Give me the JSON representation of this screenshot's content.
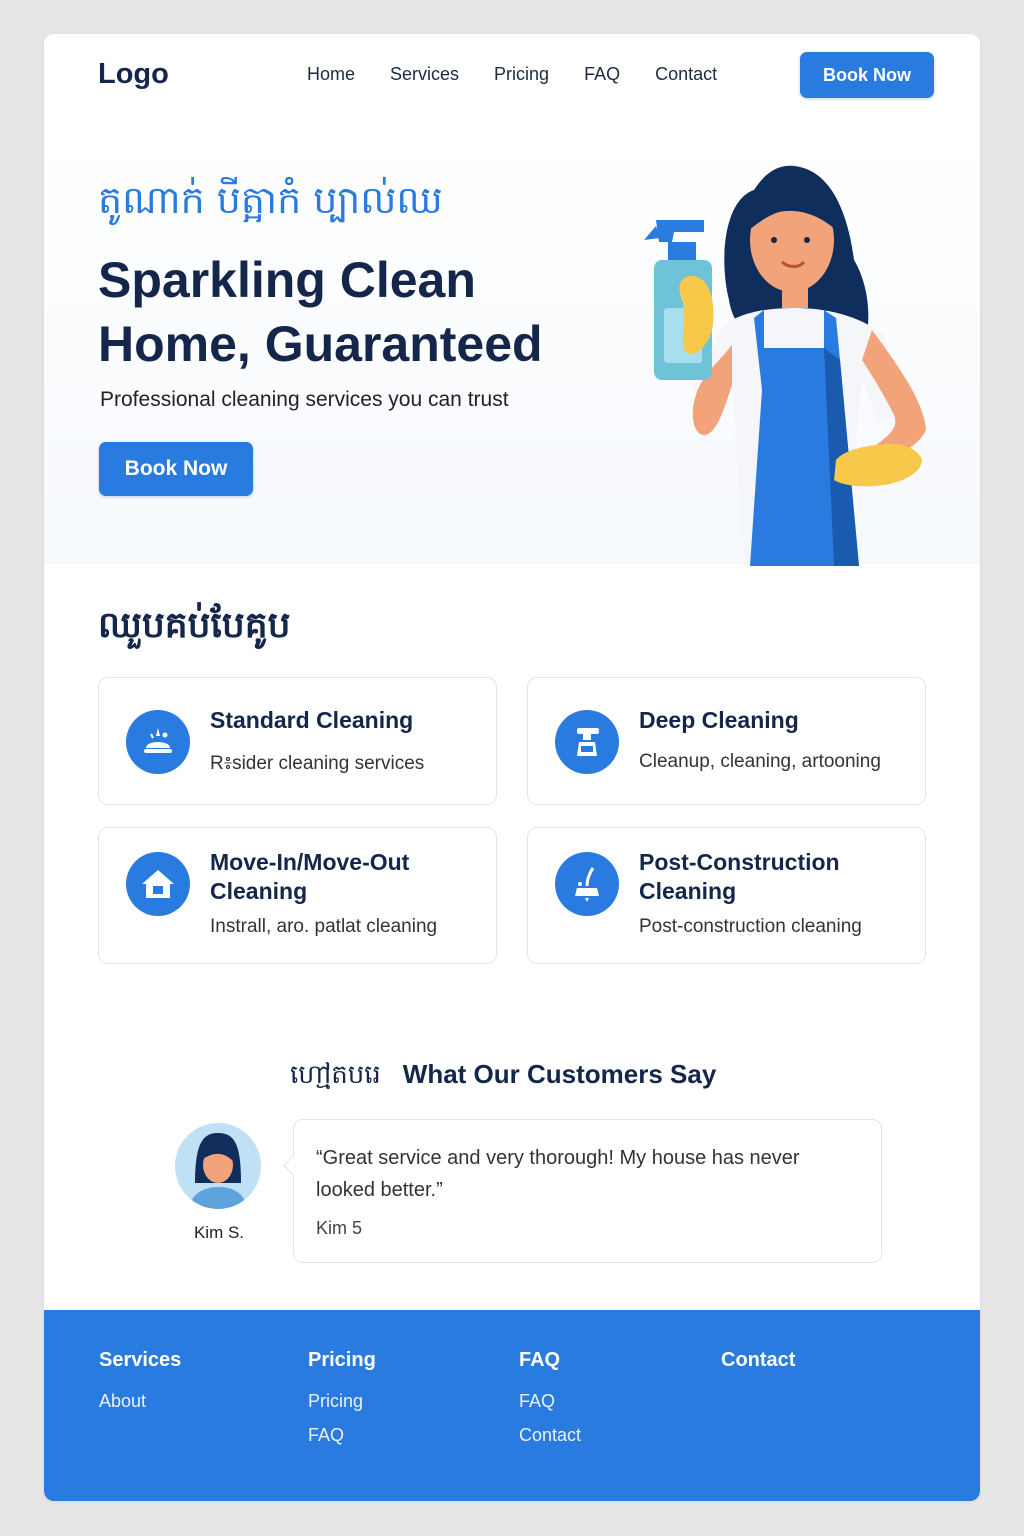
{
  "header": {
    "logo": "Logo",
    "nav": [
      "Home",
      "Services",
      "Pricing",
      "FAQ",
      "Contact"
    ],
    "book_label": "Book Now"
  },
  "hero": {
    "khmer_title": "តូណាក់ បីត្អាកំ ប្បាល់ឈ",
    "title": "Sparkling Clean Home, Guaranteed",
    "subtitle": "Professional cleaning services you can trust",
    "book_label": "Book Now"
  },
  "services": {
    "heading": "ឈួបគប់បែគូប",
    "cards": [
      {
        "title": "Standard Cleaning",
        "desc": "R៖sider cleaning services",
        "icon": "cleaning-icon"
      },
      {
        "title": "Deep Cleaning",
        "desc": "Cleanup, cleaning, artooning",
        "icon": "spray-bottle-icon"
      },
      {
        "title": "Move-In/Move-Out Cleaning",
        "desc": "Instrall, aro. patlat cleaning",
        "icon": "house-icon"
      },
      {
        "title": "Post-Construction Cleaning",
        "desc": "Post-construction cleaning",
        "icon": "broom-icon"
      }
    ]
  },
  "testimonials": {
    "heading_khmer": "ហៅ្មតបរេ",
    "heading": "What Our Customers Say",
    "quote": "“Great service and very thorough! My house has never looked better.”",
    "author_in_quote": "Kim 5",
    "avatar_name": "Kim S."
  },
  "footer": {
    "columns": [
      {
        "heading": "Services",
        "links": [
          "About"
        ]
      },
      {
        "heading": "Pricing",
        "links": [
          "Pricing",
          "FAQ"
        ]
      },
      {
        "heading": "FAQ",
        "links": [
          "FAQ",
          "Contact"
        ]
      },
      {
        "heading": "Contact",
        "links": []
      }
    ]
  },
  "colors": {
    "accent": "#2a7be0",
    "text": "#14264a",
    "footer": "#2a7be0"
  }
}
